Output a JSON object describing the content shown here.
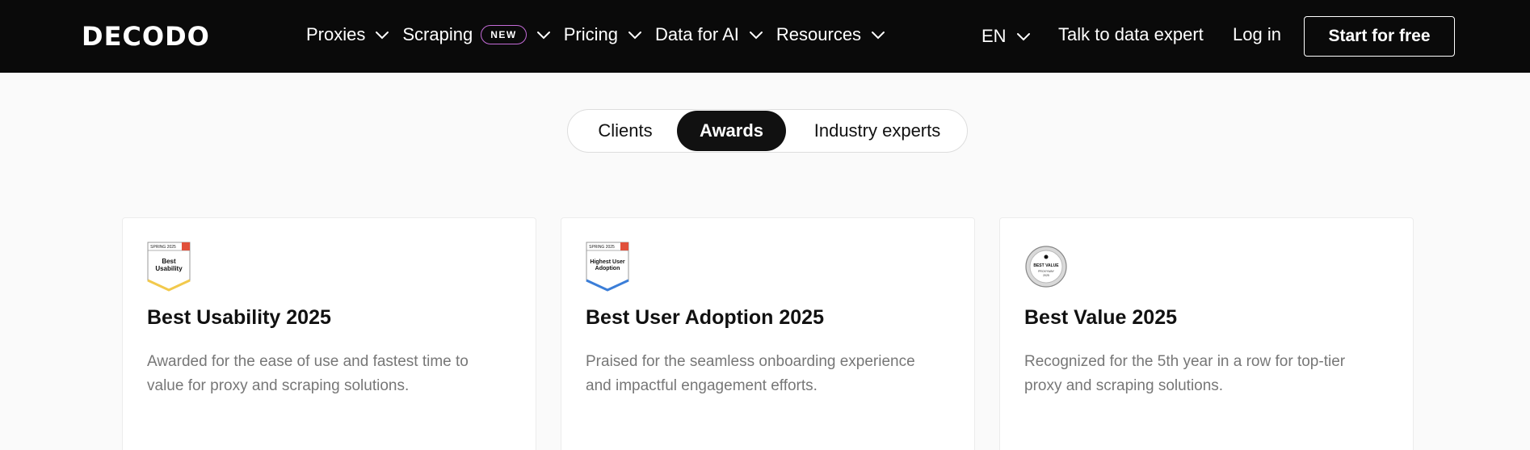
{
  "header": {
    "logo_text": "DECODO",
    "menu": [
      {
        "label": "Proxies"
      },
      {
        "label": "Scraping",
        "badge": "NEW"
      },
      {
        "label": "Pricing"
      },
      {
        "label": "Data for AI"
      },
      {
        "label": "Resources"
      }
    ],
    "language": "EN",
    "talk_label": "Talk to data expert",
    "login_label": "Log in",
    "start_label": "Start for free"
  },
  "tabs": [
    {
      "label": "Clients",
      "active": false
    },
    {
      "label": "Awards",
      "active": true
    },
    {
      "label": "Industry experts",
      "active": false
    }
  ],
  "cards": [
    {
      "badge": {
        "top": "SPRING 2025",
        "line1": "Best",
        "line2": "Usability",
        "accent": "#f2c94c",
        "icon": "g2-badge-icon"
      },
      "title": "Best Usability 2025",
      "desc": "Awarded for the ease of use and fastest time to value for proxy and scraping solutions."
    },
    {
      "badge": {
        "top": "SPRING 2025",
        "line1": "Highest User",
        "line2": "Adoption",
        "accent": "#3b7ed8",
        "icon": "g2-badge-icon"
      },
      "title": "Best User Adoption 2025",
      "desc": "Praised for the seamless onboarding experience and impactful engagement efforts."
    },
    {
      "badge": {
        "line1": "BEST VALUE",
        "line2": "PROXYWAY",
        "year": "2025",
        "icon": "proxyway-medal-icon"
      },
      "title": "Best Value 2025",
      "desc": "Recognized for the 5th year in a row for top-tier proxy and scraping solutions."
    }
  ],
  "colors": {
    "nav_bg": "#0a0a0a",
    "active_tab": "#111111",
    "g2_red": "#e1503b",
    "new_badge_border": "#c46bd8"
  }
}
